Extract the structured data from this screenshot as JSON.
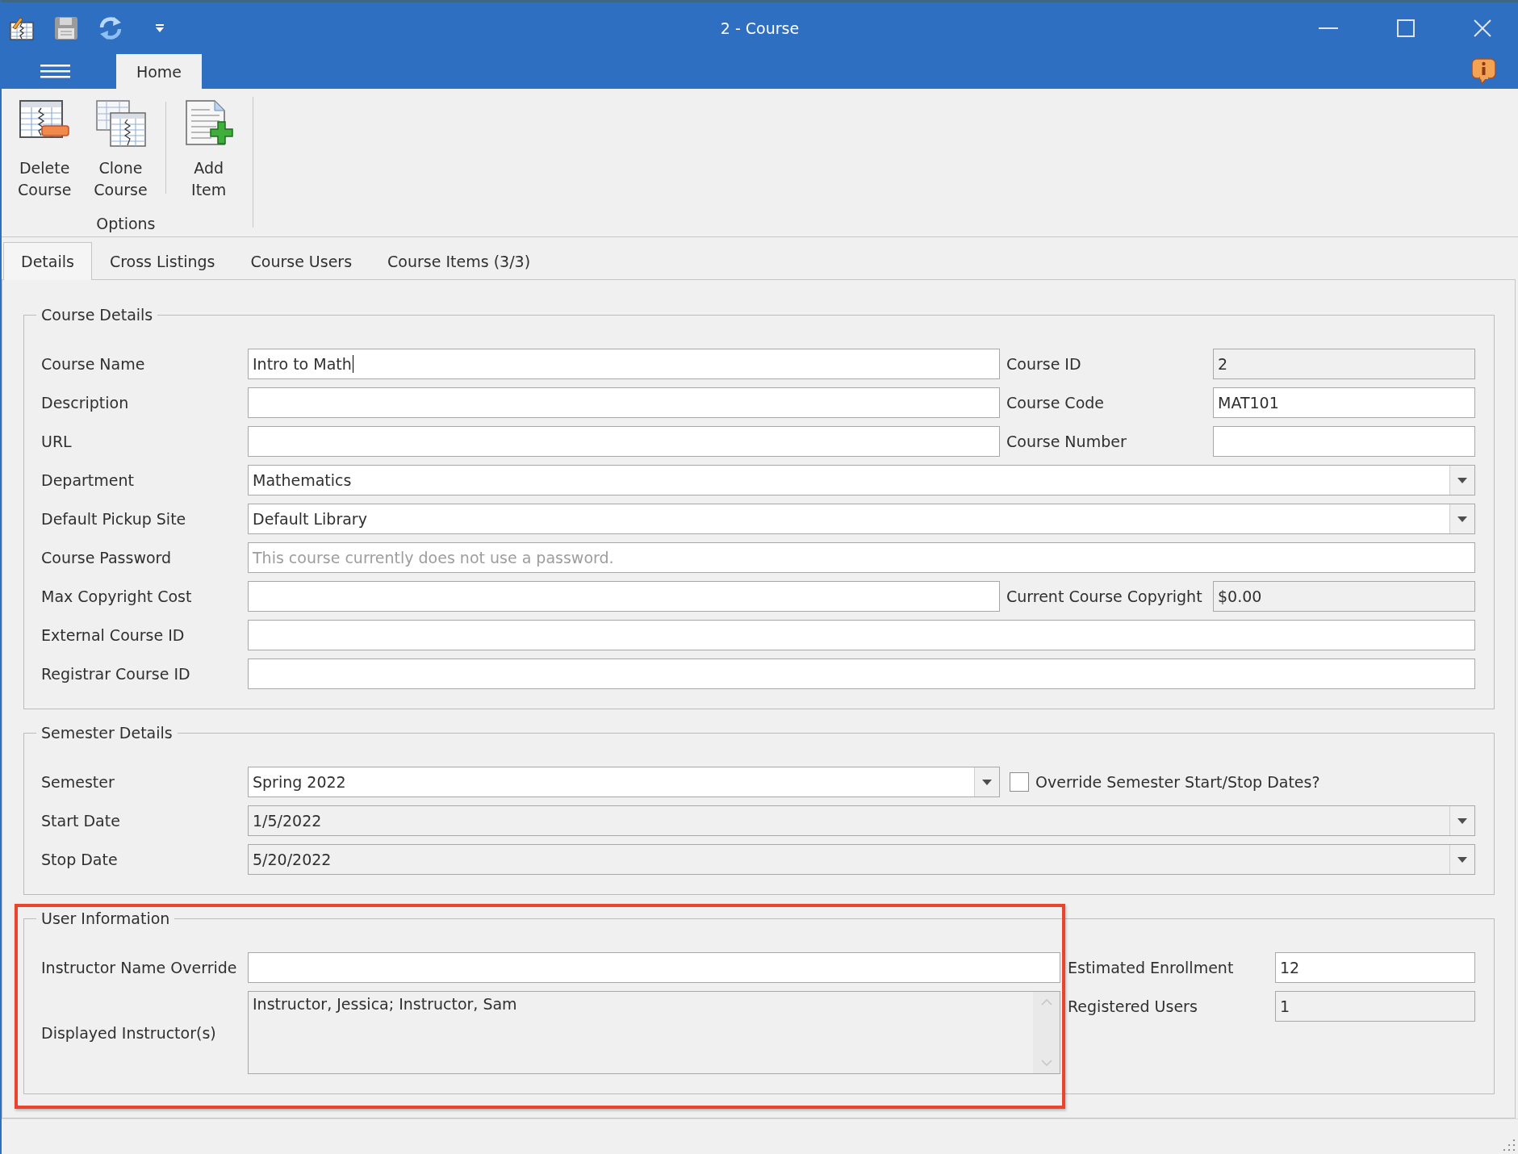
{
  "window": {
    "title": "2 - Course"
  },
  "ribbon": {
    "tabs": [
      {
        "label": "Home",
        "selected": true
      }
    ],
    "groups": [
      {
        "label": "Options",
        "button_sets": [
          {
            "buttons": [
              {
                "kind": "delete",
                "label": "Delete Course"
              },
              {
                "kind": "clone",
                "label": "Clone Course"
              }
            ]
          },
          {
            "buttons": [
              {
                "kind": "add",
                "label": "Add Item"
              }
            ]
          }
        ]
      }
    ]
  },
  "tabs": [
    {
      "label": "Details",
      "selected": true
    },
    {
      "label": "Cross Listings",
      "selected": false
    },
    {
      "label": "Course Users",
      "selected": false
    },
    {
      "label": "Course Items (3/3)",
      "selected": false
    }
  ],
  "course_details": {
    "title": "Course Details",
    "rows": [
      {
        "fields": [
          {
            "label": "Course Name",
            "kind": "text",
            "value": "Intro to Math",
            "disabled": false,
            "focused": true
          },
          {
            "label": "Course ID",
            "kind": "text",
            "value": "2",
            "disabled": true,
            "focused": false
          }
        ]
      },
      {
        "fields": [
          {
            "label": "Description",
            "kind": "text",
            "disabled": false,
            "focused": false
          },
          {
            "label": "Course Code",
            "kind": "text",
            "value": "MAT101",
            "disabled": false,
            "focused": false
          }
        ]
      },
      {
        "fields": [
          {
            "label": "URL",
            "kind": "text",
            "disabled": false,
            "focused": false
          },
          {
            "label": "Course Number",
            "kind": "text",
            "disabled": false,
            "focused": false
          }
        ]
      },
      {
        "fields": [
          {
            "label": "Department",
            "kind": "combo",
            "value": "Mathematics",
            "disabled": false,
            "focused": false
          }
        ]
      },
      {
        "fields": [
          {
            "label": "Default Pickup Site",
            "kind": "combo",
            "value": "Default Library",
            "disabled": false,
            "focused": false
          }
        ]
      },
      {
        "fields": [
          {
            "label": "Course Password",
            "kind": "text",
            "placeholder": "This course currently does not use a password.",
            "disabled": false,
            "focused": false
          }
        ]
      },
      {
        "fields": [
          {
            "label": "Max Copyright Cost",
            "kind": "text",
            "disabled": false,
            "focused": false
          },
          {
            "label": "Current Course Copyright",
            "kind": "text",
            "value": "$0.00",
            "disabled": true,
            "focused": false
          }
        ]
      },
      {
        "fields": [
          {
            "label": "External Course ID",
            "kind": "text",
            "disabled": false,
            "focused": false
          }
        ]
      },
      {
        "fields": [
          {
            "label": "Registrar Course ID",
            "kind": "text",
            "disabled": false,
            "focused": false
          }
        ]
      }
    ]
  },
  "semester_details": {
    "title": "Semester Details",
    "rows": [
      {
        "fields": [
          {
            "label": "Semester",
            "kind": "combo",
            "value": "Spring 2022",
            "disabled": false,
            "focused": false
          },
          {
            "label": "Override Semester Start/Stop Dates?",
            "kind": "checkbox",
            "checked": false,
            "disabled": false,
            "focused": false
          }
        ]
      },
      {
        "fields": [
          {
            "label": "Start Date",
            "kind": "combo",
            "value": "1/5/2022",
            "disabled": true,
            "focused": false
          }
        ]
      },
      {
        "fields": [
          {
            "label": "Stop Date",
            "kind": "combo",
            "value": "5/20/2022",
            "disabled": true,
            "focused": false
          }
        ]
      }
    ]
  },
  "user_information": {
    "title": "User Information",
    "highlighted": true,
    "rows": [
      {
        "fields": [
          {
            "label": "Instructor Name Override",
            "kind": "text",
            "disabled": false,
            "focused": false
          },
          {
            "label": "Estimated Enrollment",
            "kind": "text",
            "value": "12",
            "disabled": false,
            "focused": false
          }
        ]
      },
      {
        "fields": [
          {
            "label": "Displayed Instructor(s)",
            "kind": "memo",
            "value": "Instructor, Jessica; Instructor, Sam",
            "disabled": true,
            "focused": false
          },
          {
            "label": "Registered Users",
            "kind": "text",
            "value": "1",
            "disabled": true,
            "focused": false
          }
        ]
      }
    ]
  }
}
